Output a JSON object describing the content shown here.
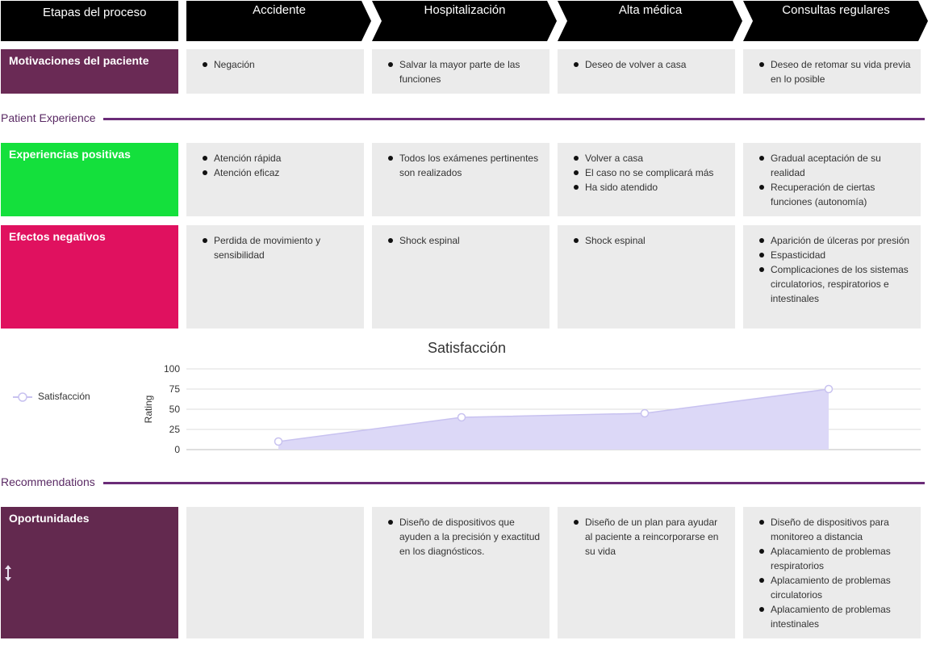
{
  "header": {
    "stages_label": "Etapas del proceso",
    "stages": [
      "Accidente",
      "Hospitalización",
      "Alta médica",
      "Consultas regulares"
    ]
  },
  "rows": {
    "motivations": {
      "label": "Motivaciones del paciente",
      "color": "#6a2a55",
      "cells": [
        [
          "Negación"
        ],
        [
          "Salvar la mayor parte de las funciones"
        ],
        [
          "Deseo de volver a casa"
        ],
        [
          "Deseo de retomar su vida previa en lo posible"
        ]
      ]
    },
    "positive": {
      "label": "Experiencias positivas",
      "color": "#14e03c",
      "cells": [
        [
          "Atención rápida",
          "Atención eficaz"
        ],
        [
          "Todos los exámenes pertinentes son realizados"
        ],
        [
          "Volver a casa",
          "El caso no se complicará más",
          "Ha sido atendido"
        ],
        [
          "Gradual aceptación de su realidad",
          "Recuperación de ciertas funciones (autonomía)"
        ]
      ]
    },
    "negative": {
      "label": "Efectos negativos",
      "color": "#e0115f",
      "cells": [
        [
          "Perdida de movimiento y sensibilidad"
        ],
        [
          "Shock espinal"
        ],
        [
          "Shock espinal"
        ],
        [
          "Aparición de úlceras por presión",
          "Espasticidad",
          "Complicaciones de los sistemas circulatorios, respiratorios e intestinales"
        ]
      ]
    },
    "opportunities": {
      "label": "Oportunidades",
      "color": "#63294f",
      "cells": [
        [],
        [
          "Diseño de dispositivos que ayuden a la precisión y exactitud en los diagnósticos."
        ],
        [
          "Diseño de un plan para ayudar al paciente a reincorporarse en su vida"
        ],
        [
          "Diseño de dispositivos para monitoreo a distancia",
          "Aplacamiento de problemas respiratorios",
          "Aplacamiento de problemas circulatorios",
          "Aplacamiento de problemas intestinales"
        ]
      ]
    }
  },
  "sections": {
    "patient_experience": "Patient Experience",
    "recommendations": "Recommendations"
  },
  "colors": {
    "accent": "#6b2c78",
    "cell_bg": "#ebebeb",
    "header_bg": "#000000",
    "area_fill": "#dcd8f7",
    "area_stroke": "#c8c2f0"
  },
  "icons": {
    "resize_handle": "vertical-resize-icon",
    "legend_marker": "circle-line-marker-icon"
  },
  "chart_data": {
    "type": "area",
    "title": "Satisfacción",
    "ylabel": "Rating",
    "xlabel": "",
    "ylim": [
      0,
      100
    ],
    "yticks": [
      100,
      75,
      50,
      25,
      0
    ],
    "categories": [
      "Accidente",
      "Hospitalización",
      "Alta médica",
      "Consultas regulares"
    ],
    "series": [
      {
        "name": "Satisfacción",
        "values": [
          10,
          40,
          45,
          75
        ]
      }
    ],
    "grid": true,
    "legend": "left"
  }
}
